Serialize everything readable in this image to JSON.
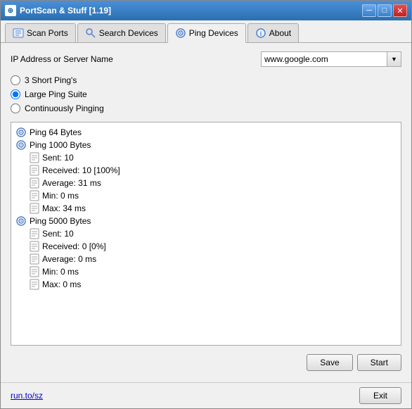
{
  "window": {
    "title": "PortScan & Stuff [1.19]"
  },
  "tabs": [
    {
      "id": "scan-ports",
      "label": "Scan Ports",
      "active": false
    },
    {
      "id": "search-devices",
      "label": "Search Devices",
      "active": false
    },
    {
      "id": "ping-devices",
      "label": "Ping Devices",
      "active": true
    },
    {
      "id": "about",
      "label": "About",
      "active": false
    }
  ],
  "ip_label": "IP Address or Server Name",
  "ip_value": "www.google.com",
  "radios": [
    {
      "id": "short-ping",
      "label": "3 Short Ping's",
      "checked": false
    },
    {
      "id": "large-ping",
      "label": "Large Ping Suite",
      "checked": true
    },
    {
      "id": "continuous-ping",
      "label": "Continuously Pinging",
      "checked": false
    }
  ],
  "results": [
    {
      "type": "ping",
      "indent": 0,
      "text": "Ping 64 Bytes"
    },
    {
      "type": "ping",
      "indent": 0,
      "text": "Ping 1000 Bytes"
    },
    {
      "type": "doc",
      "indent": 1,
      "text": "Sent: 10"
    },
    {
      "type": "doc",
      "indent": 1,
      "text": "Received: 10 [100%]"
    },
    {
      "type": "doc",
      "indent": 1,
      "text": "Average: 31 ms"
    },
    {
      "type": "doc",
      "indent": 1,
      "text": "Min: 0 ms"
    },
    {
      "type": "doc",
      "indent": 1,
      "text": "Max: 34 ms"
    },
    {
      "type": "ping",
      "indent": 0,
      "text": "Ping 5000 Bytes"
    },
    {
      "type": "doc",
      "indent": 1,
      "text": "Sent: 10"
    },
    {
      "type": "doc",
      "indent": 1,
      "text": "Received: 0 [0%]"
    },
    {
      "type": "doc",
      "indent": 1,
      "text": "Average: 0 ms"
    },
    {
      "type": "doc",
      "indent": 1,
      "text": "Min: 0 ms"
    },
    {
      "type": "doc",
      "indent": 1,
      "text": "Max: 0 ms"
    }
  ],
  "buttons": {
    "save": "Save",
    "start": "Start",
    "exit": "Exit"
  },
  "footer_link": "run.to/sz",
  "title_buttons": {
    "minimize": "─",
    "maximize": "□",
    "close": "✕"
  }
}
